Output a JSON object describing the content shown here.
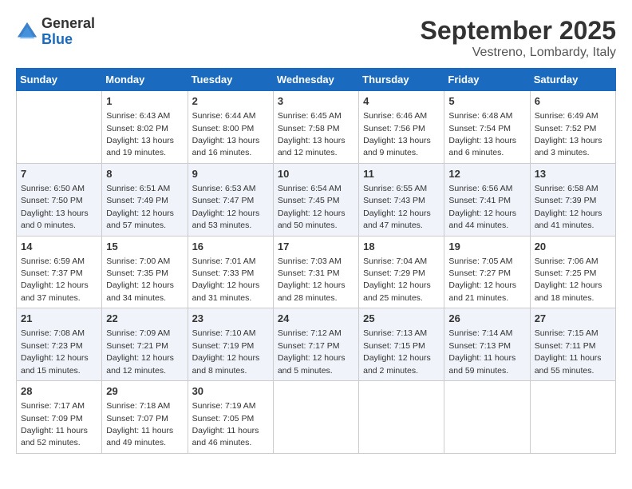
{
  "header": {
    "logo_general": "General",
    "logo_blue": "Blue",
    "month": "September 2025",
    "location": "Vestreno, Lombardy, Italy"
  },
  "columns": [
    "Sunday",
    "Monday",
    "Tuesday",
    "Wednesday",
    "Thursday",
    "Friday",
    "Saturday"
  ],
  "weeks": [
    [
      {
        "date": "",
        "sunrise": "",
        "sunset": "",
        "daylight": ""
      },
      {
        "date": "1",
        "sunrise": "6:43 AM",
        "sunset": "8:02 PM",
        "daylight": "13 hours and 19 minutes."
      },
      {
        "date": "2",
        "sunrise": "6:44 AM",
        "sunset": "8:00 PM",
        "daylight": "13 hours and 16 minutes."
      },
      {
        "date": "3",
        "sunrise": "6:45 AM",
        "sunset": "7:58 PM",
        "daylight": "13 hours and 12 minutes."
      },
      {
        "date": "4",
        "sunrise": "6:46 AM",
        "sunset": "7:56 PM",
        "daylight": "13 hours and 9 minutes."
      },
      {
        "date": "5",
        "sunrise": "6:48 AM",
        "sunset": "7:54 PM",
        "daylight": "13 hours and 6 minutes."
      },
      {
        "date": "6",
        "sunrise": "6:49 AM",
        "sunset": "7:52 PM",
        "daylight": "13 hours and 3 minutes."
      }
    ],
    [
      {
        "date": "7",
        "sunrise": "6:50 AM",
        "sunset": "7:50 PM",
        "daylight": "13 hours and 0 minutes."
      },
      {
        "date": "8",
        "sunrise": "6:51 AM",
        "sunset": "7:49 PM",
        "daylight": "12 hours and 57 minutes."
      },
      {
        "date": "9",
        "sunrise": "6:53 AM",
        "sunset": "7:47 PM",
        "daylight": "12 hours and 53 minutes."
      },
      {
        "date": "10",
        "sunrise": "6:54 AM",
        "sunset": "7:45 PM",
        "daylight": "12 hours and 50 minutes."
      },
      {
        "date": "11",
        "sunrise": "6:55 AM",
        "sunset": "7:43 PM",
        "daylight": "12 hours and 47 minutes."
      },
      {
        "date": "12",
        "sunrise": "6:56 AM",
        "sunset": "7:41 PM",
        "daylight": "12 hours and 44 minutes."
      },
      {
        "date": "13",
        "sunrise": "6:58 AM",
        "sunset": "7:39 PM",
        "daylight": "12 hours and 41 minutes."
      }
    ],
    [
      {
        "date": "14",
        "sunrise": "6:59 AM",
        "sunset": "7:37 PM",
        "daylight": "12 hours and 37 minutes."
      },
      {
        "date": "15",
        "sunrise": "7:00 AM",
        "sunset": "7:35 PM",
        "daylight": "12 hours and 34 minutes."
      },
      {
        "date": "16",
        "sunrise": "7:01 AM",
        "sunset": "7:33 PM",
        "daylight": "12 hours and 31 minutes."
      },
      {
        "date": "17",
        "sunrise": "7:03 AM",
        "sunset": "7:31 PM",
        "daylight": "12 hours and 28 minutes."
      },
      {
        "date": "18",
        "sunrise": "7:04 AM",
        "sunset": "7:29 PM",
        "daylight": "12 hours and 25 minutes."
      },
      {
        "date": "19",
        "sunrise": "7:05 AM",
        "sunset": "7:27 PM",
        "daylight": "12 hours and 21 minutes."
      },
      {
        "date": "20",
        "sunrise": "7:06 AM",
        "sunset": "7:25 PM",
        "daylight": "12 hours and 18 minutes."
      }
    ],
    [
      {
        "date": "21",
        "sunrise": "7:08 AM",
        "sunset": "7:23 PM",
        "daylight": "12 hours and 15 minutes."
      },
      {
        "date": "22",
        "sunrise": "7:09 AM",
        "sunset": "7:21 PM",
        "daylight": "12 hours and 12 minutes."
      },
      {
        "date": "23",
        "sunrise": "7:10 AM",
        "sunset": "7:19 PM",
        "daylight": "12 hours and 8 minutes."
      },
      {
        "date": "24",
        "sunrise": "7:12 AM",
        "sunset": "7:17 PM",
        "daylight": "12 hours and 5 minutes."
      },
      {
        "date": "25",
        "sunrise": "7:13 AM",
        "sunset": "7:15 PM",
        "daylight": "12 hours and 2 minutes."
      },
      {
        "date": "26",
        "sunrise": "7:14 AM",
        "sunset": "7:13 PM",
        "daylight": "11 hours and 59 minutes."
      },
      {
        "date": "27",
        "sunrise": "7:15 AM",
        "sunset": "7:11 PM",
        "daylight": "11 hours and 55 minutes."
      }
    ],
    [
      {
        "date": "28",
        "sunrise": "7:17 AM",
        "sunset": "7:09 PM",
        "daylight": "11 hours and 52 minutes."
      },
      {
        "date": "29",
        "sunrise": "7:18 AM",
        "sunset": "7:07 PM",
        "daylight": "11 hours and 49 minutes."
      },
      {
        "date": "30",
        "sunrise": "7:19 AM",
        "sunset": "7:05 PM",
        "daylight": "11 hours and 46 minutes."
      },
      {
        "date": "",
        "sunrise": "",
        "sunset": "",
        "daylight": ""
      },
      {
        "date": "",
        "sunrise": "",
        "sunset": "",
        "daylight": ""
      },
      {
        "date": "",
        "sunrise": "",
        "sunset": "",
        "daylight": ""
      },
      {
        "date": "",
        "sunrise": "",
        "sunset": "",
        "daylight": ""
      }
    ]
  ],
  "labels": {
    "sunrise_prefix": "Sunrise: ",
    "sunset_prefix": "Sunset: ",
    "daylight_prefix": "Daylight: "
  }
}
